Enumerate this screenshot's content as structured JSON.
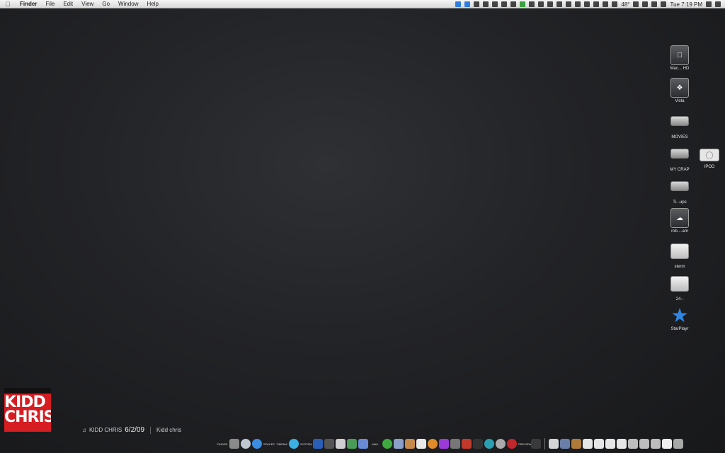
{
  "menubar": {
    "apple_icon": "apple-icon",
    "items": [
      "Finder",
      "File",
      "Edit",
      "View",
      "Go",
      "Window",
      "Help"
    ],
    "status": {
      "temperature": "48°",
      "clock": "Tue 7:19 PM"
    }
  },
  "desktop_icons": [
    {
      "label": "Mac... HD",
      "icon": "hard-drive-icon"
    },
    {
      "label": "Vista",
      "icon": "windows-drive-icon"
    },
    {
      "label": "MOVIES",
      "icon": "external-drive-icon"
    },
    {
      "label": "MY CRAP",
      "icon": "external-drive-icon"
    },
    {
      "label": "IPOD",
      "icon": "ipod-icon"
    },
    {
      "label": "Ti...ups",
      "icon": "external-drive-icon"
    },
    {
      "label": "rob....am",
      "icon": "network-drive-icon"
    },
    {
      "label": "sterm",
      "icon": "folder-icon"
    },
    {
      "label": "24--",
      "icon": "folder-icon"
    },
    {
      "label": "StarPlayr",
      "icon": "star-app-icon"
    }
  ],
  "logo": {
    "line1": "KIDD",
    "line2": "CHRIS"
  },
  "now_playing": {
    "artist": "KIDD CHRIS",
    "date": "6/2/09",
    "title": "Kidd chris"
  },
  "dock": {
    "labels": [
      "FINDER",
      "SPACES",
      "TIMEMA",
      "SYSTEM",
      "MAIL",
      "PREVIEW"
    ]
  },
  "colors": {
    "logo_red": "#d51d22",
    "accent_blue": "#2e7de0",
    "star_blue": "#2f86e0"
  }
}
